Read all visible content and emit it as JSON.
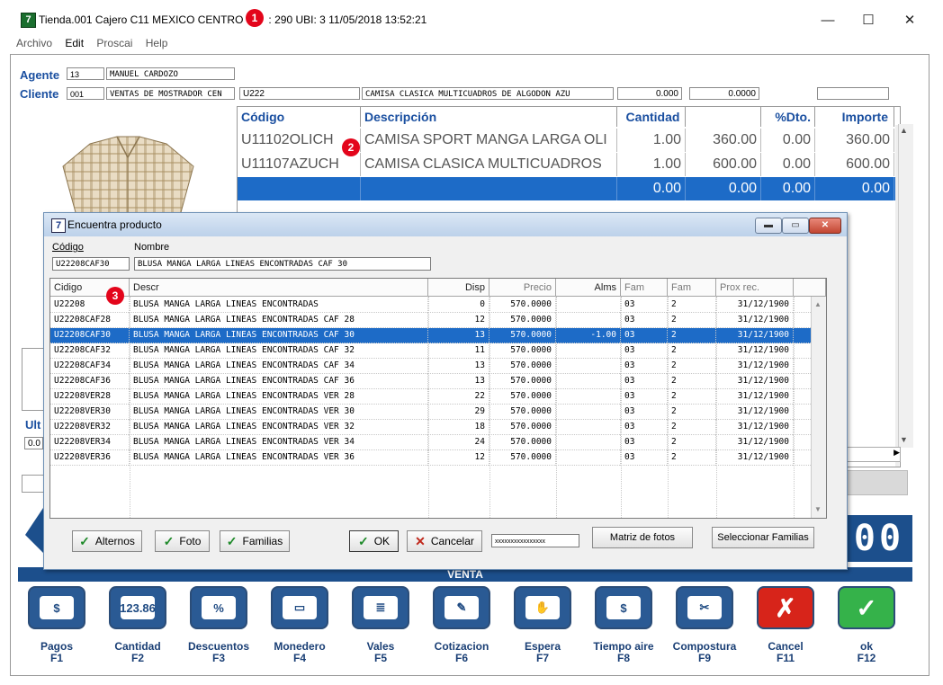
{
  "window": {
    "title_prefix": "Tienda.001  Cajero C11  MEXICO CENTRO",
    "title_suffix": ": 290  UBI: 3  11/05/2018 13:52:21",
    "app_icon": "7",
    "minimize": "—",
    "maximize": "☐",
    "close": "✕"
  },
  "markers": [
    "1",
    "2",
    "3"
  ],
  "menu": [
    "Archivo",
    "Edit",
    "Proscai",
    "Help"
  ],
  "agent": {
    "label": "Agente",
    "code": "13",
    "name": "MANUEL CARDOZO"
  },
  "client": {
    "label": "Cliente",
    "code": "001",
    "name": "VENTAS DE MOSTRADOR CEN"
  },
  "entry": {
    "code": "U222",
    "desc": "CAMISA CLASICA MULTICUADROS DE ALGODON AZU",
    "qty": "0.000",
    "price": "0.0000",
    "extra": ""
  },
  "main_grid": {
    "headers": [
      "Código",
      "Descripción",
      "Cantidad",
      "",
      "%Dto.",
      "Importe"
    ],
    "rows": [
      {
        "code": "U11102OLICH",
        "desc": "CAMISA SPORT MANGA LARGA OLI",
        "qty": "1.00",
        "price": "360.00",
        "dto": "0.00",
        "imp": "360.00"
      },
      {
        "code": "U11107AZUCH",
        "desc": "CAMISA CLASICA MULTICUADROS",
        "qty": "1.00",
        "price": "600.00",
        "dto": "0.00",
        "imp": "600.00"
      },
      {
        "code": "",
        "desc": "",
        "qty": "0.00",
        "price": "0.00",
        "dto": "0.00",
        "imp": "0.00"
      }
    ]
  },
  "side": {
    "ult_label": "Ult",
    "ult_value": "0.0",
    "big_display": "00"
  },
  "dialog": {
    "title": "Encuentra producto",
    "code_label": "Código",
    "name_label": "Nombre",
    "code_value": "U22208CAF30",
    "name_value": "BLUSA MANGA LARGA LINEAS ENCONTRADAS CAF 30",
    "headers": [
      "Cidigo",
      "Descr",
      "Disp",
      "Precio",
      "Alms",
      "Fam",
      "Fam",
      "Prox rec."
    ],
    "rows": [
      {
        "code": "U22208",
        "descr": "BLUSA MANGA LARGA LINEAS ENCONTRADAS",
        "disp": "0",
        "precio": "570.0000",
        "alms": "",
        "fam1": "03",
        "fam2": "2",
        "prox": "31/12/1900"
      },
      {
        "code": "U22208CAF28",
        "descr": "BLUSA MANGA LARGA LINEAS ENCONTRADAS CAF 28",
        "disp": "12",
        "precio": "570.0000",
        "alms": "",
        "fam1": "03",
        "fam2": "2",
        "prox": "31/12/1900"
      },
      {
        "code": "U22208CAF30",
        "descr": "BLUSA MANGA LARGA LINEAS ENCONTRADAS CAF 30",
        "disp": "13",
        "precio": "570.0000",
        "alms": "-1.00",
        "fam1": "03",
        "fam2": "2",
        "prox": "31/12/1900"
      },
      {
        "code": "U22208CAF32",
        "descr": "BLUSA MANGA LARGA LINEAS ENCONTRADAS CAF 32",
        "disp": "11",
        "precio": "570.0000",
        "alms": "",
        "fam1": "03",
        "fam2": "2",
        "prox": "31/12/1900"
      },
      {
        "code": "U22208CAF34",
        "descr": "BLUSA MANGA LARGA LINEAS ENCONTRADAS CAF 34",
        "disp": "13",
        "precio": "570.0000",
        "alms": "",
        "fam1": "03",
        "fam2": "2",
        "prox": "31/12/1900"
      },
      {
        "code": "U22208CAF36",
        "descr": "BLUSA MANGA LARGA LINEAS ENCONTRADAS CAF 36",
        "disp": "13",
        "precio": "570.0000",
        "alms": "",
        "fam1": "03",
        "fam2": "2",
        "prox": "31/12/1900"
      },
      {
        "code": "U22208VER28",
        "descr": "BLUSA MANGA LARGA LINEAS ENCONTRADAS VER 28",
        "disp": "22",
        "precio": "570.0000",
        "alms": "",
        "fam1": "03",
        "fam2": "2",
        "prox": "31/12/1900"
      },
      {
        "code": "U22208VER30",
        "descr": "BLUSA MANGA LARGA LINEAS ENCONTRADAS VER 30",
        "disp": "29",
        "precio": "570.0000",
        "alms": "",
        "fam1": "03",
        "fam2": "2",
        "prox": "31/12/1900"
      },
      {
        "code": "U22208VER32",
        "descr": "BLUSA MANGA LARGA LINEAS ENCONTRADAS VER 32",
        "disp": "18",
        "precio": "570.0000",
        "alms": "",
        "fam1": "03",
        "fam2": "2",
        "prox": "31/12/1900"
      },
      {
        "code": "U22208VER34",
        "descr": "BLUSA MANGA LARGA LINEAS ENCONTRADAS VER 34",
        "disp": "24",
        "precio": "570.0000",
        "alms": "",
        "fam1": "03",
        "fam2": "2",
        "prox": "31/12/1900"
      },
      {
        "code": "U22208VER36",
        "descr": "BLUSA MANGA LARGA LINEAS ENCONTRADAS VER 36",
        "disp": "12",
        "precio": "570.0000",
        "alms": "",
        "fam1": "03",
        "fam2": "2",
        "prox": "31/12/1900"
      }
    ],
    "selected_index": 2,
    "buttons": {
      "alternos": "Alternos",
      "foto": "Foto",
      "familias": "Familias",
      "ok": "OK",
      "cancelar": "Cancelar",
      "password": "xxxxxxxxxxxxxxxx",
      "matriz": "Matriz de fotos",
      "seleccionar": "Seleccionar Familias"
    }
  },
  "venta_label": "VENTA",
  "function_keys": [
    {
      "label": "Pagos",
      "key": "F1",
      "icon": "cash-icon",
      "glyph": "$",
      "color": "#2a5a94"
    },
    {
      "label": "Cantidad",
      "key": "F2",
      "icon": "calculator-icon",
      "glyph": "123.86",
      "color": "#2a5a94"
    },
    {
      "label": "Descuentos",
      "key": "F3",
      "icon": "percent-icon",
      "glyph": "%",
      "color": "#2a5a94"
    },
    {
      "label": "Monedero",
      "key": "F4",
      "icon": "wallet-icon",
      "glyph": "▭",
      "color": "#2a5a94"
    },
    {
      "label": "Vales",
      "key": "F5",
      "icon": "voucher-icon",
      "glyph": "≣",
      "color": "#2a5a94"
    },
    {
      "label": "Cotizacion",
      "key": "F6",
      "icon": "quote-icon",
      "glyph": "✎",
      "color": "#2a5a94"
    },
    {
      "label": "Espera",
      "key": "F7",
      "icon": "hand-icon",
      "glyph": "✋",
      "color": "#2a5a94"
    },
    {
      "label": "Tiempo aire",
      "key": "F8",
      "icon": "phone-icon",
      "glyph": "$",
      "color": "#2a5a94"
    },
    {
      "label": "Compostura",
      "key": "F9",
      "icon": "scissors-icon",
      "glyph": "✂",
      "color": "#2a5a94"
    },
    {
      "label": "Cancel",
      "key": "F11",
      "icon": "cancel-icon",
      "glyph": "✗",
      "color": "#d7241a"
    },
    {
      "label": "ok",
      "key": "F12",
      "icon": "check-icon",
      "glyph": "✓",
      "color": "#35b24a"
    }
  ]
}
